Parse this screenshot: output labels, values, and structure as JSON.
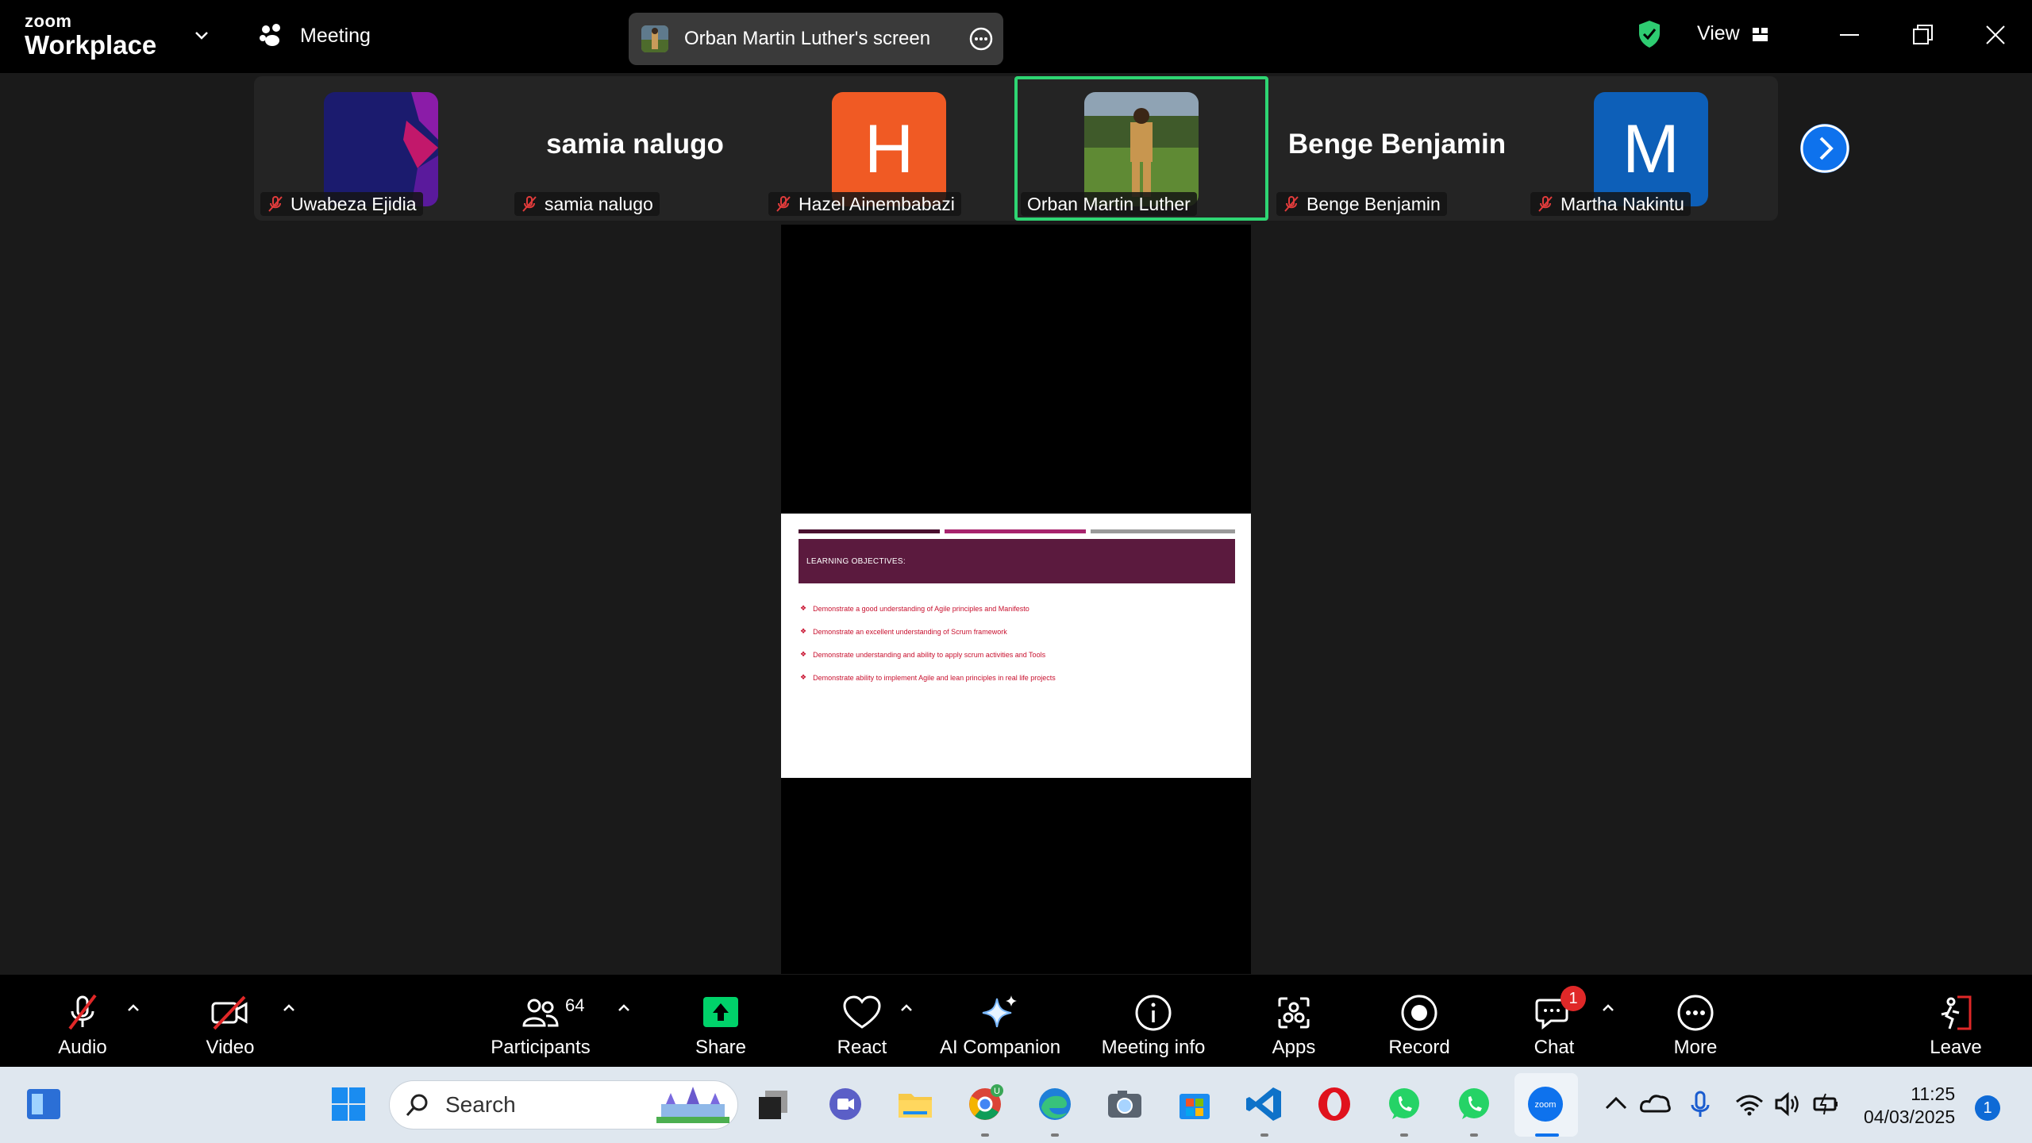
{
  "titlebar": {
    "brand_top": "zoom",
    "brand_bottom": "Workplace",
    "meeting_label": "Meeting",
    "share_title": "Orban Martin Luther's screen",
    "view_label": "View"
  },
  "participants_strip": [
    {
      "name": "Uwabeza Ejidia",
      "muted": true,
      "avatar": "image"
    },
    {
      "name": "samia nalugo",
      "muted": true,
      "avatar": "name",
      "display": "samia nalugo"
    },
    {
      "name": "Hazel Ainembabazi",
      "muted": true,
      "avatar": "letter",
      "letter": "H",
      "color": "#f05a24"
    },
    {
      "name": "Orban Martin Luther",
      "muted": false,
      "avatar": "video",
      "active": true
    },
    {
      "name": "Benge Benjamin",
      "muted": true,
      "avatar": "name",
      "display": "Benge Benjamin"
    },
    {
      "name": "Martha Nakintu",
      "muted": true,
      "avatar": "letter",
      "letter": "M",
      "color": "#0d5fb8"
    }
  ],
  "slide": {
    "heading": "LEARNING OBJECTIVES:",
    "bullets": [
      "Demonstrate a good understanding of Agile principles and Manifesto",
      "Demonstrate an excellent understanding of Scrum framework",
      "Demonstrate  understanding and ability to apply scrum activities and Tools",
      "Demonstrate ability to implement Agile and lean principles in real life projects"
    ],
    "header_color": "#5b1a3e",
    "bullet_color": "#c8102e"
  },
  "toolbar": {
    "audio": "Audio",
    "video": "Video",
    "participants": "Participants",
    "participants_count": "64",
    "share": "Share",
    "react": "React",
    "ai_companion": "AI Companion",
    "meeting_info": "Meeting info",
    "apps": "Apps",
    "record": "Record",
    "chat": "Chat",
    "chat_badge": "1",
    "more": "More",
    "leave": "Leave"
  },
  "taskbar": {
    "search_placeholder": "Search",
    "time": "11:25",
    "date": "04/03/2025",
    "notifications": "1"
  },
  "colors": {
    "accent_green": "#2ed573",
    "zoom_blue": "#0e72ed",
    "share_green": "#00d26a"
  }
}
